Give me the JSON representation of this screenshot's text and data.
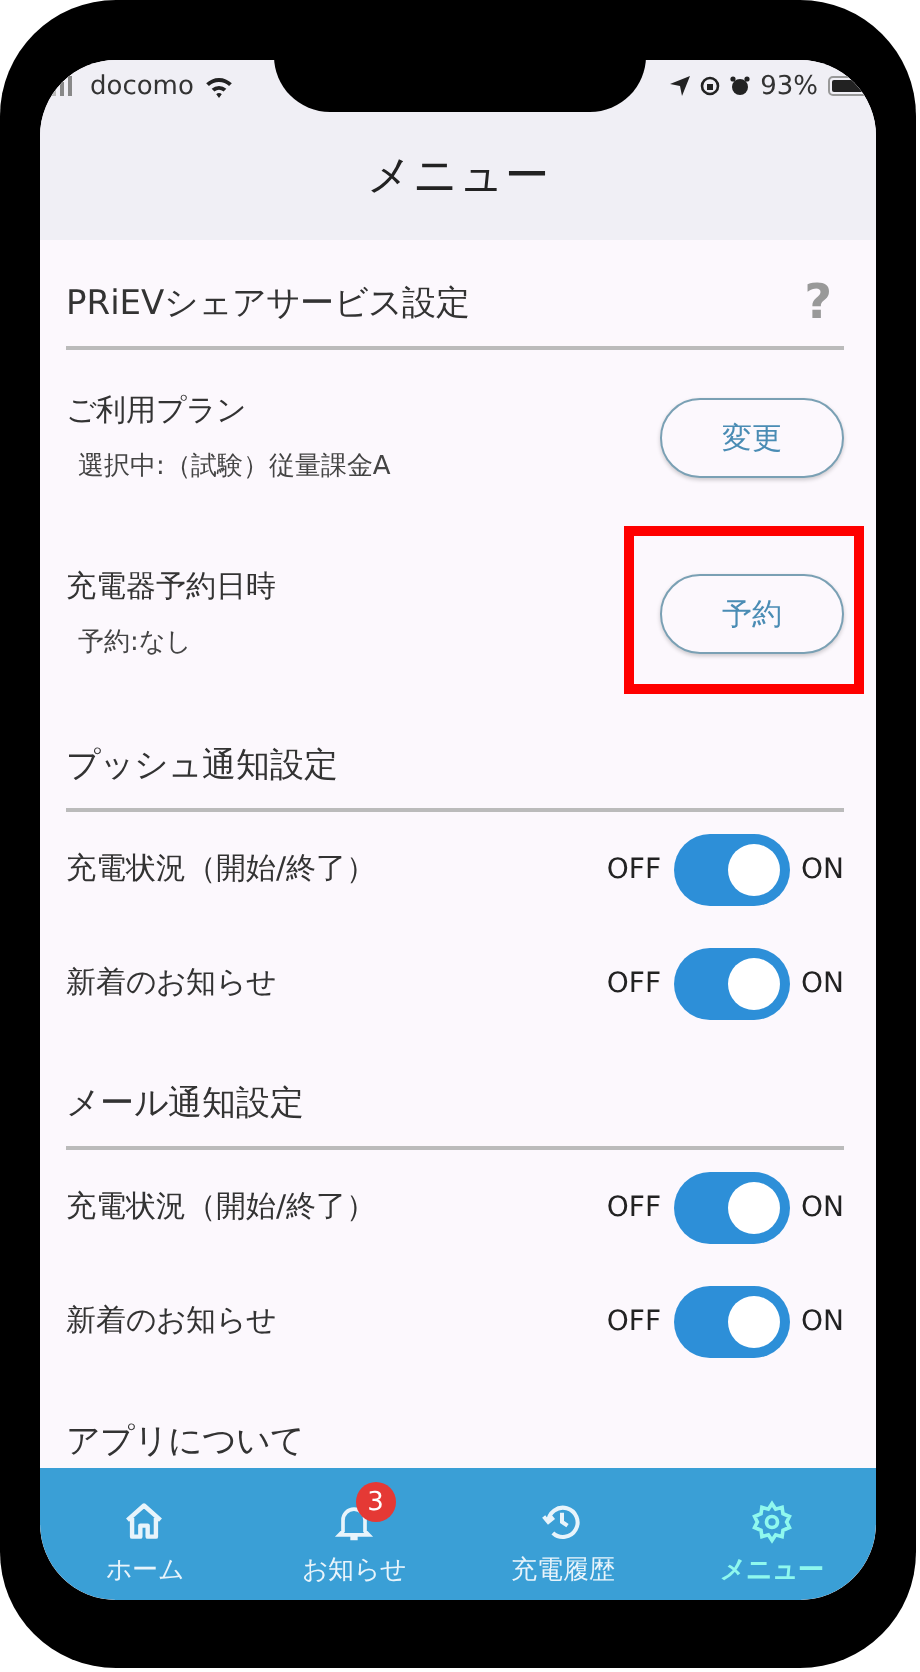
{
  "status_bar": {
    "carrier": "docomo",
    "battery": "93%"
  },
  "header": {
    "title": "メニュー"
  },
  "sections": [
    {
      "title": "PRiEVシェアサービス設定",
      "help": "?",
      "rows": [
        {
          "kind": "button",
          "label": "ご利用プラン",
          "detail": "選択中:（試験）従量課金A",
          "button": "変更",
          "highlighted": false
        },
        {
          "kind": "button",
          "label": "充電器予約日時",
          "detail": "予約:なし",
          "button": "予約",
          "highlighted": true
        }
      ]
    },
    {
      "title": "プッシュ通知設定",
      "rows": [
        {
          "kind": "toggle",
          "label": "充電状況（開始/終了）",
          "off_label": "OFF",
          "on_label": "ON",
          "on": true
        },
        {
          "kind": "toggle",
          "label": "新着のお知らせ",
          "off_label": "OFF",
          "on_label": "ON",
          "on": true
        }
      ]
    },
    {
      "title": "メール通知設定",
      "rows": [
        {
          "kind": "toggle",
          "label": "充電状況（開始/終了）",
          "off_label": "OFF",
          "on_label": "ON",
          "on": true
        },
        {
          "kind": "toggle",
          "label": "新着のお知らせ",
          "off_label": "OFF",
          "on_label": "ON",
          "on": true
        }
      ]
    },
    {
      "title": "アプリについて"
    }
  ],
  "tab_bar": [
    {
      "kind": "home",
      "label": "ホーム",
      "selected": false
    },
    {
      "kind": "bell",
      "label": "お知らせ",
      "badge": "3",
      "selected": false
    },
    {
      "kind": "history",
      "label": "充電履歴",
      "selected": false
    },
    {
      "kind": "gear",
      "label": "メニュー",
      "selected": true
    }
  ]
}
